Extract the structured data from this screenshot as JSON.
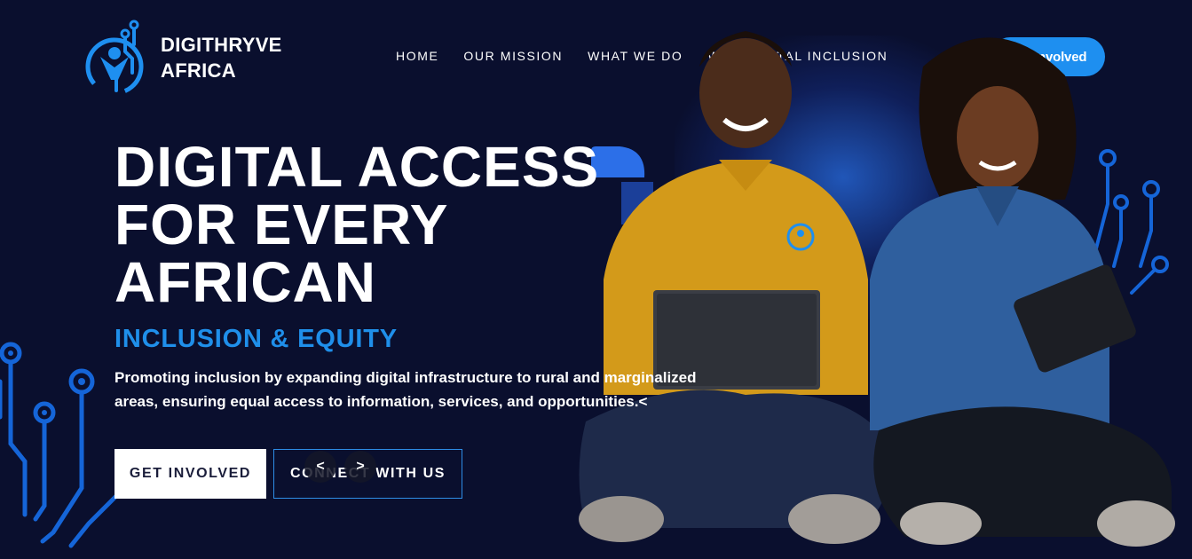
{
  "brand": {
    "name_line1": "DIGITHRYVE",
    "name_line2": "AFRICA",
    "logo_icon": "digithryve-logo-icon"
  },
  "nav": {
    "items": [
      {
        "label": "HOME"
      },
      {
        "label": "OUR MISSION"
      },
      {
        "label": "WHAT WE DO"
      },
      {
        "label": "WHY DIGITAL INCLUSION"
      }
    ],
    "cta_label": "Get Involved"
  },
  "hero": {
    "title_lines": [
      "DIGITAL ACCESS",
      "FOR EVERY",
      "AFRICAN"
    ],
    "subtitle": "INCLUSION & EQUITY",
    "description": "Promoting inclusion by expanding digital infrastructure to rural and marginalized areas, ensuring equal access to information, services, and opportunities.<",
    "primary_button": "GET INVOLVED",
    "secondary_button": "CONNECT WITH US",
    "prev_arrow": "<",
    "next_arrow": ">"
  },
  "colors": {
    "background": "#0a0f2e",
    "accent": "#1e8ff0",
    "subtitle": "#1f8fea"
  }
}
